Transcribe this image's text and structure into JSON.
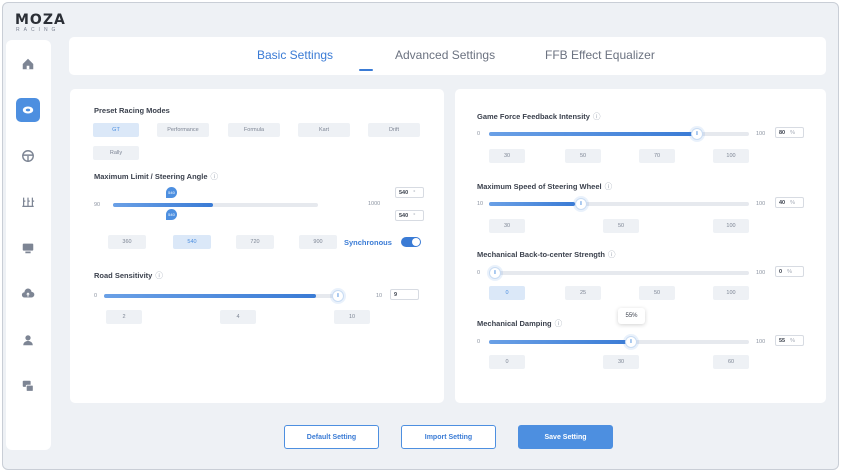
{
  "brand": {
    "name": "MOZA",
    "sub": "RACING"
  },
  "sidebar": {
    "items": [
      {
        "icon": "home-icon"
      },
      {
        "icon": "wheelbase-icon",
        "active": true
      },
      {
        "icon": "steering-wheel-icon"
      },
      {
        "icon": "pedals-icon"
      },
      {
        "icon": "dashboard-icon"
      },
      {
        "icon": "cloud-icon"
      },
      {
        "icon": "user-icon"
      },
      {
        "icon": "devices-icon"
      }
    ],
    "accent": "#4d8fe0"
  },
  "tabs": [
    {
      "label": "Basic Settings",
      "active": true
    },
    {
      "label": "Advanced Settings"
    },
    {
      "label": "FFB Effect Equalizer"
    }
  ],
  "left": {
    "preset": {
      "title": "Preset Racing Modes",
      "modes": [
        "GT",
        "Performance",
        "Formula",
        "Kart",
        "Drift",
        "Rally"
      ],
      "selected": "GT"
    },
    "steering": {
      "title": "Maximum Limit / Steering Angle",
      "min_label": "90",
      "max_label": "1000",
      "value_top": "540",
      "value_bottom": "540",
      "unit": "°",
      "pin_label": "540",
      "fraction": 0.49,
      "presets": [
        "360",
        "540",
        "720",
        "900"
      ],
      "selected_preset": "540",
      "sync_label": "Synchronous",
      "sync_on": true
    },
    "road": {
      "title": "Road Sensitivity",
      "min_label": "0",
      "max_label": "10",
      "value": "9",
      "fraction": 0.9,
      "presets": [
        "2",
        "4",
        "10"
      ]
    }
  },
  "right": {
    "ffb_intensity": {
      "title": "Game Force Feedback Intensity",
      "min_label": "0",
      "max_label": "100",
      "value": "80",
      "unit": "%",
      "fraction": 0.8,
      "presets": [
        "30",
        "50",
        "70",
        "100"
      ],
      "selected_preset": ""
    },
    "max_speed": {
      "title": "Maximum Speed of Steering Wheel",
      "min_label": "10",
      "max_label": "100",
      "value": "40",
      "unit": "%",
      "fraction": 0.33,
      "presets": [
        "30",
        "50",
        "100"
      ],
      "selected_preset": ""
    },
    "back_to_center": {
      "title": "Mechanical Back-to-center Strength",
      "min_label": "0",
      "max_label": "100",
      "value": "0",
      "unit": "%",
      "fraction": 0.0,
      "presets": [
        "0",
        "25",
        "50",
        "100"
      ],
      "selected_preset": "0"
    },
    "damping": {
      "title": "Mechanical Damping",
      "min_label": "0",
      "max_label": "100",
      "value": "55",
      "unit": "%",
      "fraction": 0.55,
      "tooltip": "55%",
      "presets": [
        "0",
        "30",
        "60"
      ],
      "selected_preset": ""
    }
  },
  "footer": {
    "default_label": "Default Setting",
    "import_label": "Import Setting",
    "save_label": "Save Setting"
  },
  "info_symbol": "ⓘ",
  "handle_glyph": "⦀"
}
